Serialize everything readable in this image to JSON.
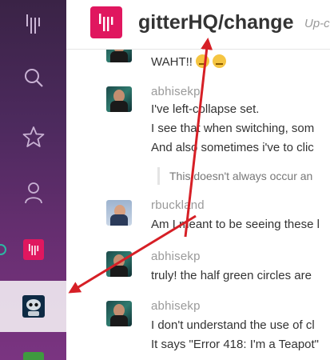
{
  "sidebar": {
    "items": [
      {
        "name": "gitter-logo-icon"
      },
      {
        "name": "search-icon"
      },
      {
        "name": "star-icon"
      },
      {
        "name": "user-icon"
      },
      {
        "name": "room-gitterhq-icon"
      },
      {
        "name": "room-robot-avatar-icon"
      },
      {
        "name": "room-green-icon"
      }
    ]
  },
  "header": {
    "title": "gitterHQ/change",
    "topic": "Up-c"
  },
  "messages": [
    {
      "text": "WAHT!!"
    },
    {
      "username": "abhisekp",
      "lines": [
        "I've left-collapse set.",
        "I see that when switching, som",
        "And also sometimes i've to clic"
      ],
      "quote": "This doesn't always occur an"
    },
    {
      "username": "rbuckland",
      "lines": [
        "Am I meant to be seeing these l"
      ]
    },
    {
      "username": "abhisekp",
      "lines": [
        "truly! the half green circles are"
      ]
    },
    {
      "username": "abhisekp",
      "lines": [
        "I don't understand the use of cl",
        "It says \"Error 418: I'm a Teapot\""
      ]
    }
  ],
  "colors": {
    "accent": "#e0175f",
    "annotation": "#d61f26",
    "rail_top": "#3a2346",
    "rail_bottom": "#7a3481"
  }
}
